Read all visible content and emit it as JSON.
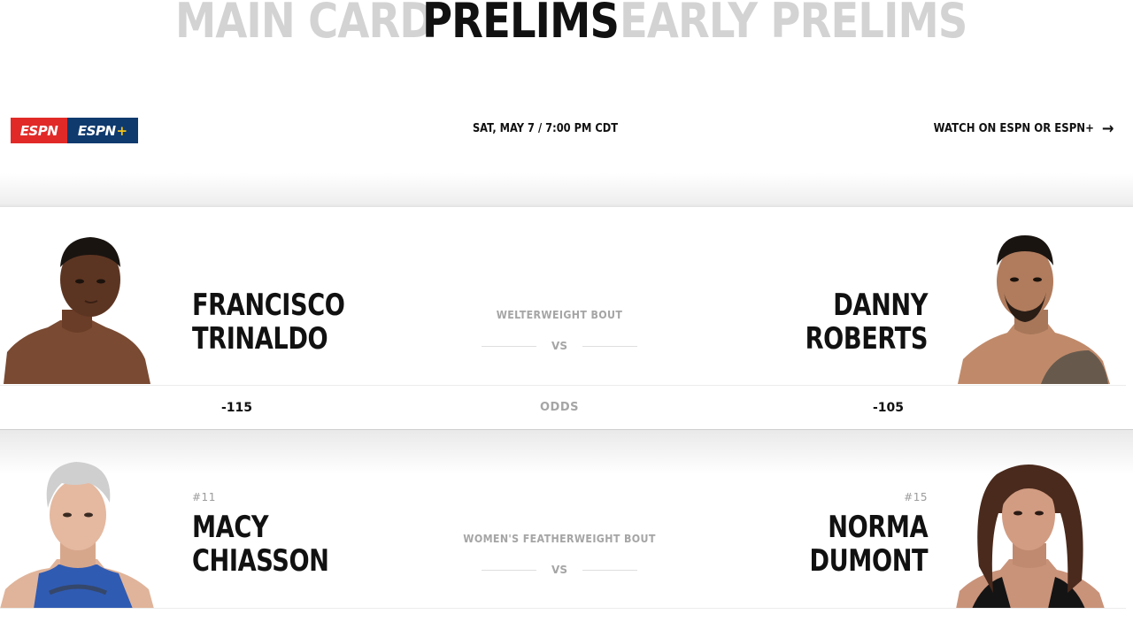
{
  "tabs": [
    {
      "label": "MAIN CARD",
      "active": false
    },
    {
      "label": "PRELIMS",
      "active": true
    },
    {
      "label": "EARLY PRELIMS",
      "active": false
    }
  ],
  "broadcast": {
    "logos": [
      {
        "text": "ESPN",
        "color": "#e12a27"
      },
      {
        "text": "ESPN",
        "plus": "+",
        "color": "#0f3a6e"
      }
    ],
    "time": "SAT, MAY 7 / 7:00 PM CDT",
    "watch_label": "WATCH ON ESPN OR ESPN+",
    "watch_icon": "arrow-right-icon"
  },
  "bouts": [
    {
      "weight_class": "WELTERWEIGHT BOUT",
      "vs": "VS",
      "red": {
        "first": "FRANCISCO",
        "last": "TRINALDO",
        "rank": "",
        "odds": "-115"
      },
      "blue": {
        "first": "DANNY",
        "last": "ROBERTS",
        "rank": "",
        "odds": "-105"
      },
      "odds_label": "ODDS"
    },
    {
      "weight_class": "WOMEN'S FEATHERWEIGHT BOUT",
      "vs": "VS",
      "red": {
        "first": "MACY",
        "last": "CHIASSON",
        "rank": "#11"
      },
      "blue": {
        "first": "NORMA",
        "last": "DUMONT",
        "rank": "#15"
      }
    }
  ],
  "colors": {
    "inactive_tab": "#d3d3d3",
    "active_tab": "#111111",
    "muted_text": "#a5a5a5"
  }
}
